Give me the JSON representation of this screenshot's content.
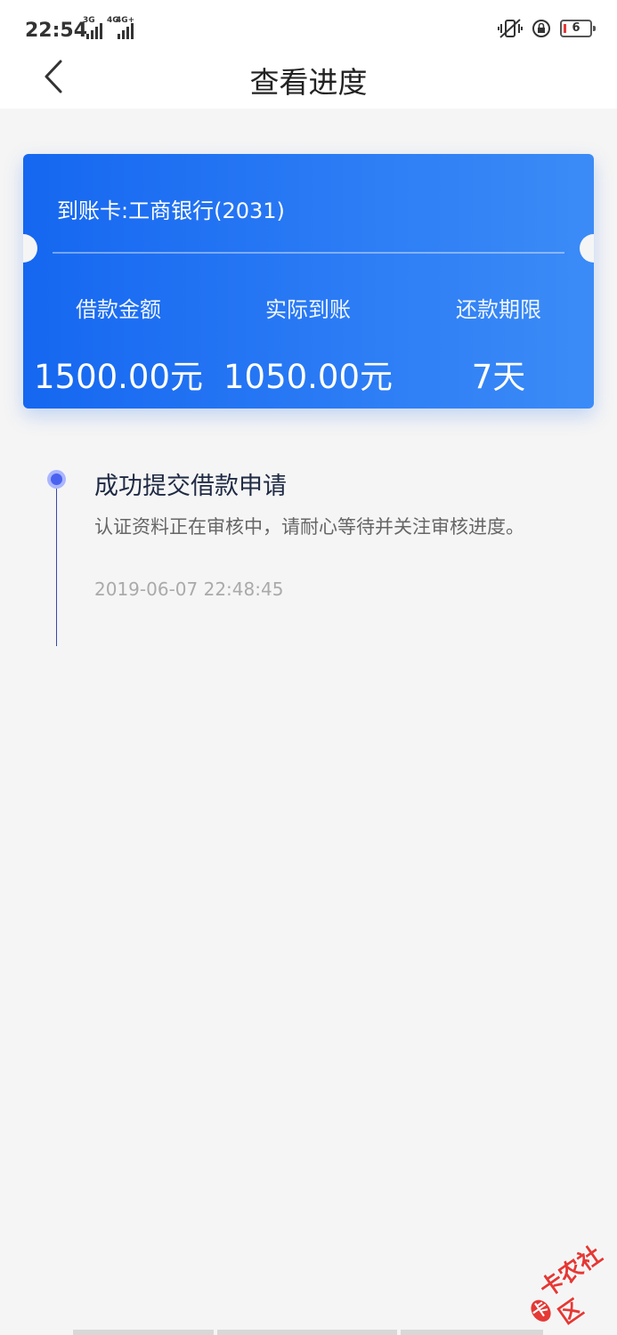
{
  "status_bar": {
    "time": "22:54",
    "net1": "3G",
    "net2": "4G+",
    "net2_prefix": "4G",
    "battery": "6"
  },
  "header": {
    "title": "查看进度",
    "back_icon": "chevron-left-icon"
  },
  "card": {
    "account": "到账卡:工商银行(2031)",
    "loan_amount": {
      "label": "借款金额",
      "value": "1500.00元"
    },
    "actual_received": {
      "label": "实际到账",
      "value": "1050.00元"
    },
    "repayment_term": {
      "label": "还款期限",
      "value": "7天"
    },
    "gradient_start": "#1567f0",
    "gradient_end": "#3b8bf7"
  },
  "timeline": {
    "steps": [
      {
        "title": "成功提交借款申请",
        "description": "认证资料正在审核中，请耐心等待并关注审核进度。",
        "time": "2019-06-07 22:48:45"
      }
    ],
    "dot_color": "#4a62f0",
    "line_color": "#3949ab"
  },
  "watermark": {
    "text": "卡农社区",
    "logo": "卡"
  }
}
